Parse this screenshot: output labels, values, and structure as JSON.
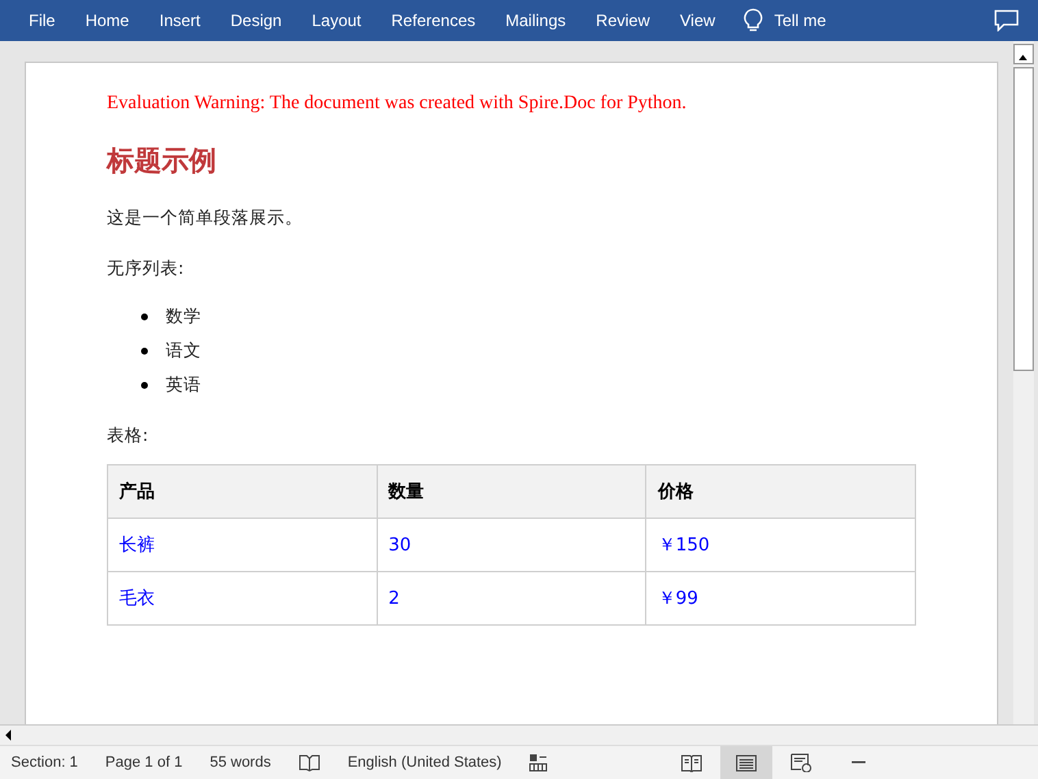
{
  "ribbon": {
    "tabs": [
      {
        "label": "File"
      },
      {
        "label": "Home"
      },
      {
        "label": "Insert"
      },
      {
        "label": "Design"
      },
      {
        "label": "Layout"
      },
      {
        "label": "References"
      },
      {
        "label": "Mailings"
      },
      {
        "label": "Review"
      },
      {
        "label": "View"
      }
    ],
    "tell_me": "Tell me"
  },
  "document": {
    "warning": "Evaluation Warning: The document was created with Spire.Doc for Python.",
    "heading": "标题示例",
    "paragraph": "这是一个简单段落展示。",
    "list_label": "无序列表:",
    "list_items": [
      "数学",
      "语文",
      "英语"
    ],
    "table_label": "表格:",
    "table": {
      "columns": [
        "产品",
        "数量",
        "价格"
      ],
      "rows": [
        [
          "长裤",
          "30",
          "￥150"
        ],
        [
          "毛衣",
          "2",
          "￥99"
        ]
      ]
    }
  },
  "status_bar": {
    "section": "Section: 1",
    "page": "Page 1 of 1",
    "words": "55 words",
    "language": "English (United States)",
    "views": [
      {
        "kind": "read",
        "selected": false
      },
      {
        "kind": "print",
        "selected": true
      },
      {
        "kind": "web",
        "selected": false
      }
    ]
  }
}
